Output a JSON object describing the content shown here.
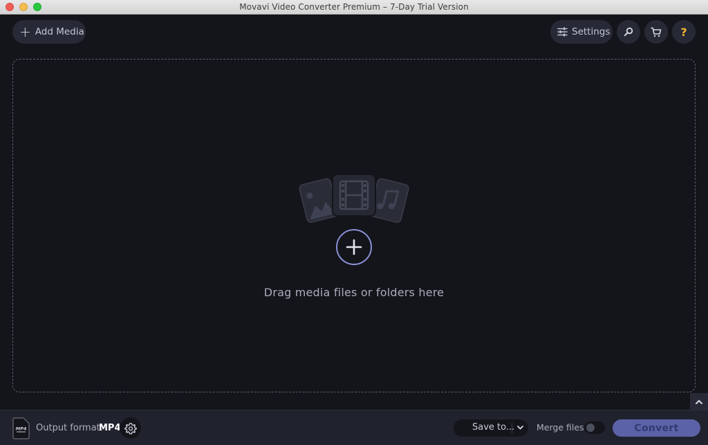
{
  "window": {
    "title": "Movavi Video Converter Premium – 7-Day Trial Version"
  },
  "toolbar": {
    "add_media_label": "Add Media",
    "settings_label": "Settings",
    "search_icon": "search-icon",
    "cart_icon": "cart-icon",
    "help_label": "?"
  },
  "dropzone": {
    "message": "Drag media files or folders here",
    "icons": [
      "image-icon",
      "film-icon",
      "music-icon"
    ],
    "add_icon": "plus-circle-icon"
  },
  "bottombar": {
    "format_icon_text": "MP4",
    "output_format_label": "Output format:",
    "output_format_value": "MP4",
    "save_to_label": "Save to...",
    "merge_files_label": "Merge files:",
    "merge_files_enabled": false,
    "convert_label": "Convert"
  },
  "colors": {
    "background": "#14151b",
    "panel": "#20232e",
    "accent": "#5b62a7",
    "accent_ring": "#8a91d6",
    "help_icon": "#f3b231"
  }
}
